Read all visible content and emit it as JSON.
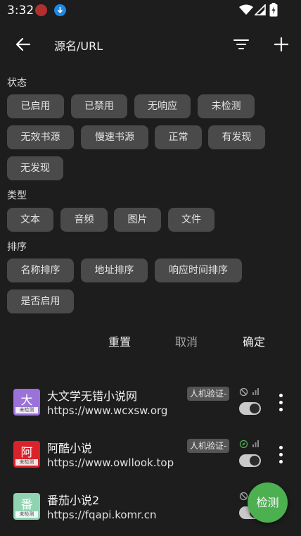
{
  "status_bar": {
    "time": "3:32"
  },
  "toolbar": {
    "title": "源名/URL"
  },
  "filters": {
    "status": {
      "label": "状态",
      "chips": [
        "已启用",
        "已禁用",
        "无响应",
        "未检测",
        "无效书源",
        "慢速书源",
        "正常",
        "有发现",
        "无发现"
      ]
    },
    "type": {
      "label": "类型",
      "chips": [
        "文本",
        "音频",
        "图片",
        "文件"
      ]
    },
    "sort": {
      "label": "排序",
      "chips": [
        "名称排序",
        "地址排序",
        "响应时间排序",
        "是否启用"
      ]
    },
    "actions": {
      "reset": "重置",
      "cancel": "取消",
      "confirm": "确定"
    }
  },
  "sources": [
    {
      "icon_char": "大",
      "icon_color": "#9b72d9",
      "badge": "未检测",
      "name": "大文学无错小说网",
      "url": "https://www.wcxsw.org",
      "tag": "人机验证-",
      "enabled": true
    },
    {
      "icon_char": "阿",
      "icon_color": "#d9222a",
      "badge": "未检测",
      "name": "阿酷小说",
      "url": "https://www.owllook.top",
      "tag": "人机验证-",
      "enabled": true
    },
    {
      "icon_char": "番",
      "icon_color": "#8fd3b2",
      "badge": "未检测",
      "name": "番茄小说2",
      "url": "https://fqapi.komr.cn",
      "tag": "",
      "enabled": true
    }
  ],
  "fab": {
    "label": "检测"
  },
  "colors": {
    "background": "#1d1d1d",
    "chip": "#4a4a4a",
    "fab": "#4caf50"
  }
}
